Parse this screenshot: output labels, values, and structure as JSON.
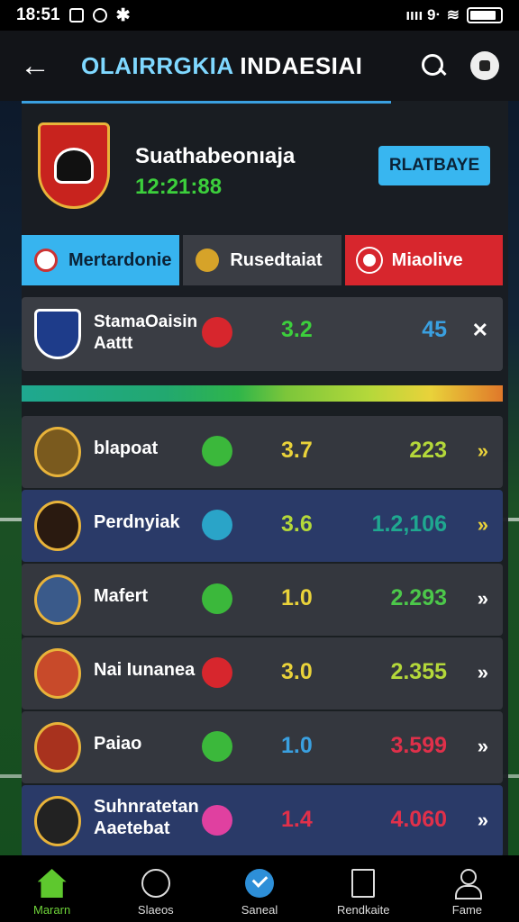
{
  "status_bar": {
    "time": "18:51",
    "signal_text": "ıııı 9ᐧ"
  },
  "app_bar": {
    "title_part1": "OLAIRRGKIA",
    "title_part2": " INDAESIAI"
  },
  "match": {
    "team_name": "Suathabeonıaja",
    "time": "12:21:88",
    "play_button": "RLATBAYE"
  },
  "tabs": [
    {
      "label": "Mertardonie"
    },
    {
      "label": "Rusedtaiat"
    },
    {
      "label": "Miaolive"
    }
  ],
  "featured": {
    "name_line1": "StamaOaisin",
    "name_line2": "Aattt",
    "score": "3.2",
    "value": "45",
    "action_glyph": "✕"
  },
  "rows": [
    {
      "name": "blapoat",
      "score": "3.7",
      "value": "223",
      "score_color": "#e9d23a",
      "value_color": "#b4d83a",
      "dot_color": "#3bb83b",
      "style": "dark",
      "logo_color": "#7a5a1e"
    },
    {
      "name": "Perdnyiak",
      "score": "3.6",
      "value": "1.2,106",
      "score_color": "#b4d83a",
      "value_color": "#1fa890",
      "dot_color": "#2aa4c8",
      "style": "blue",
      "logo_color": "#2a1a10"
    },
    {
      "name": "Mafert",
      "score": "1.0",
      "value": "2.293",
      "score_color": "#e9d23a",
      "value_color": "#4cc84a",
      "dot_color": "#3bb83b",
      "style": "dark",
      "logo_color": "#3a5a8a"
    },
    {
      "name": "Nai Iunanea",
      "score": "3.0",
      "value": "2.355",
      "score_color": "#e9d23a",
      "value_color": "#b4d83a",
      "dot_color": "#d7262d",
      "style": "dark",
      "logo_color": "#c84a2a"
    },
    {
      "name": "Paiao",
      "score": "1.0",
      "value": "3.599",
      "score_color": "#3aa0e0",
      "value_color": "#e0304a",
      "dot_color": "#3bb83b",
      "style": "dark",
      "logo_color": "#a8321e"
    },
    {
      "name": "Suhnratetan",
      "name2": "Aaetebat",
      "score": "1.4",
      "value": "4.060",
      "score_color": "#e0304a",
      "value_color": "#e0304a",
      "dot_color": "#e040a0",
      "style": "blue",
      "logo_color": "#222222"
    }
  ],
  "bottom_nav": [
    {
      "label": "Mararn",
      "icon": "home-icon"
    },
    {
      "label": "Slaeos",
      "icon": "whistle-icon"
    },
    {
      "label": "Saneal",
      "icon": "check-icon"
    },
    {
      "label": "Rendkaite",
      "icon": "document-icon"
    },
    {
      "label": "Fame",
      "icon": "person-icon"
    }
  ]
}
